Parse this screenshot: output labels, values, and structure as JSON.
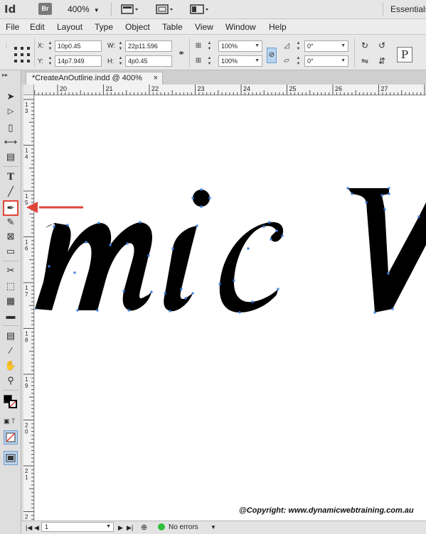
{
  "app": {
    "logo": "Id",
    "bridge_label": "Br",
    "zoom": "400%",
    "workspace": "Essentials"
  },
  "menu": [
    "File",
    "Edit",
    "Layout",
    "Type",
    "Object",
    "Table",
    "View",
    "Window",
    "Help"
  ],
  "control_panel": {
    "x_label": "X:",
    "x_value": "10p0.45",
    "y_label": "Y:",
    "y_value": "14p7.949",
    "w_label": "W:",
    "w_value": "22p11.596",
    "h_label": "H:",
    "h_value": "4p0.45",
    "scale_x": "100%",
    "scale_y": "100%",
    "rotate": "0°",
    "shear": "0°",
    "text_frame_icon": "P"
  },
  "document": {
    "tab_title": "*CreateAnOutline.indd @ 400%",
    "close": "×",
    "ruler_h_labels": [
      "20",
      "21",
      "22",
      "23",
      "24",
      "25",
      "26",
      "27"
    ],
    "ruler_v_labels": [
      "1",
      "3",
      "1",
      "4",
      "1",
      "5",
      "1",
      "6",
      "1",
      "7",
      "1",
      "8",
      "1",
      "9",
      "2",
      "0",
      "2",
      "1",
      "2",
      "2"
    ],
    "text_fragments": [
      "m",
      "i",
      "c",
      "V"
    ]
  },
  "tools": [
    "selection-tool",
    "direct-selection-tool",
    "page-tool",
    "gap-tool",
    "content-collector-tool",
    "type-tool",
    "line-tool",
    "pen-tool",
    "pencil-tool",
    "rectangle-frame-tool",
    "rectangle-tool",
    "scissors-tool",
    "free-transform-tool",
    "gradient-swatch-tool",
    "gradient-feather-tool",
    "note-tool",
    "eyedropper-tool",
    "hand-tool",
    "zoom-tool"
  ],
  "annotation": {
    "copyright": "@Copyright: www.dynamicwebtraining.com.au",
    "arrow_color": "#e0453a"
  },
  "status": {
    "page": "1",
    "preflight": "No errors",
    "preflight_color": "#2fbf3a"
  }
}
